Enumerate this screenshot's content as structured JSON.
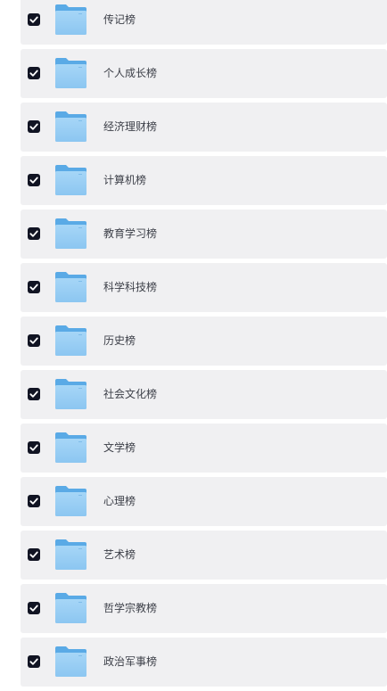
{
  "folders": [
    {
      "name": "传记榜",
      "checked": true
    },
    {
      "name": "个人成长榜",
      "checked": true
    },
    {
      "name": "经济理财榜",
      "checked": true
    },
    {
      "name": "计算机榜",
      "checked": true
    },
    {
      "name": "教育学习榜",
      "checked": true
    },
    {
      "name": "科学科技榜",
      "checked": true
    },
    {
      "name": "历史榜",
      "checked": true
    },
    {
      "name": "社会文化榜",
      "checked": true
    },
    {
      "name": "文学榜",
      "checked": true
    },
    {
      "name": "心理榜",
      "checked": true
    },
    {
      "name": "艺术榜",
      "checked": true
    },
    {
      "name": "哲学宗教榜",
      "checked": true
    },
    {
      "name": "政治军事榜",
      "checked": true
    }
  ],
  "colors": {
    "row_bg": "#f0f0f2",
    "checkbox_fill": "#111423",
    "folder_back": "#5aaae6",
    "folder_front": "#9ccff4",
    "text": "#3c3f48"
  },
  "icons": {
    "checkbox": "checkbox-checked-icon",
    "folder": "folder-icon"
  }
}
